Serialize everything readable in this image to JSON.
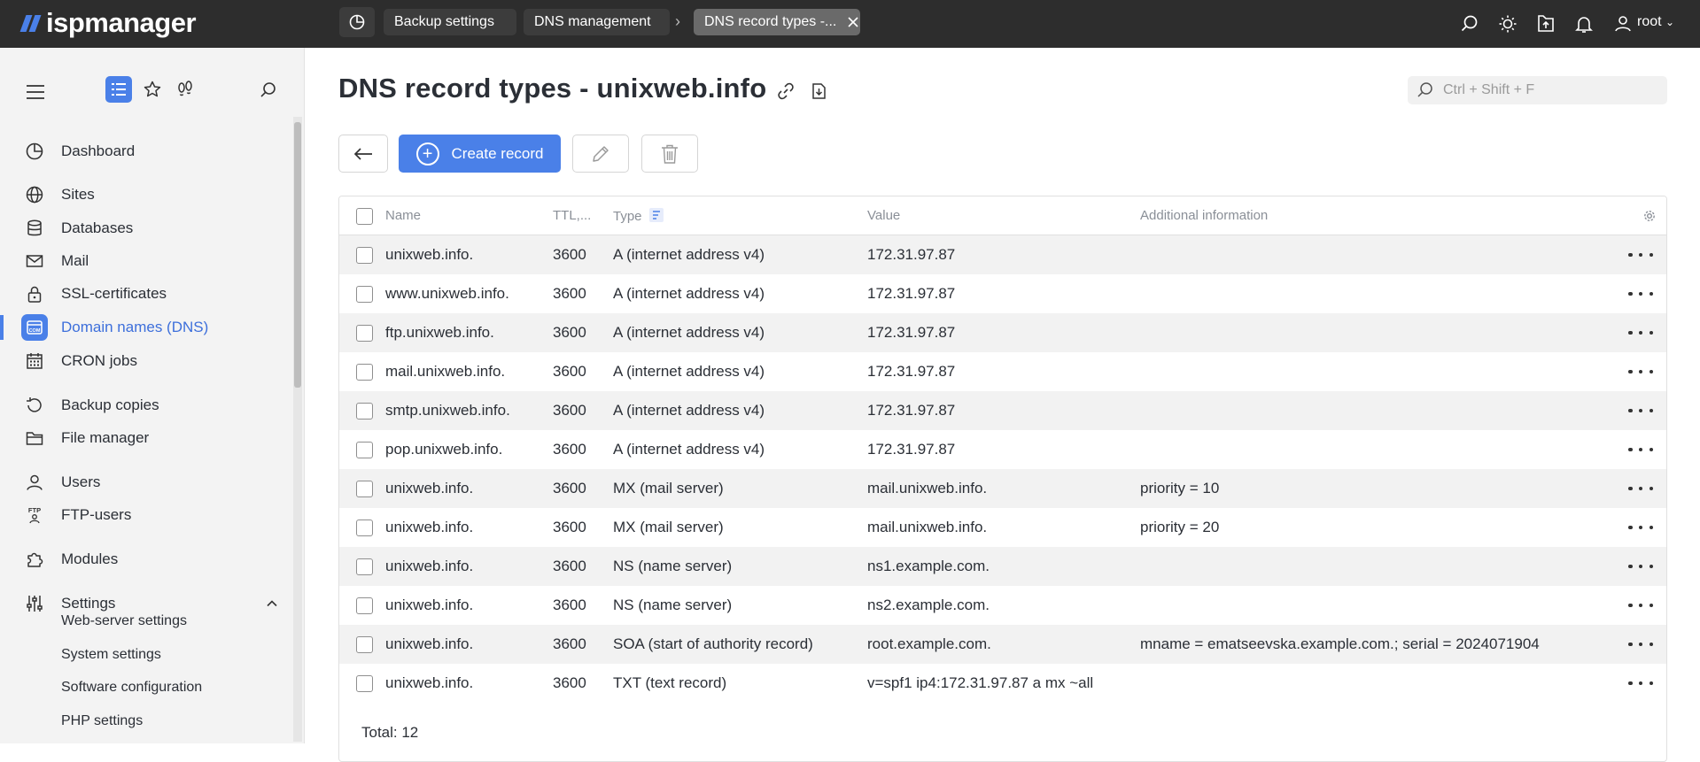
{
  "app": {
    "logo": "ispmanager"
  },
  "tabs": [
    {
      "label": "Backup settings"
    },
    {
      "label": "DNS management"
    },
    {
      "label": "DNS record types -..."
    }
  ],
  "user": {
    "name": "root"
  },
  "sidebar": {
    "items": [
      {
        "label": "Dashboard",
        "icon": "dashboard-icon"
      },
      {
        "label": "Sites",
        "icon": "globe-icon"
      },
      {
        "label": "Databases",
        "icon": "database-icon"
      },
      {
        "label": "Mail",
        "icon": "mail-icon"
      },
      {
        "label": "SSL-certificates",
        "icon": "lock-icon"
      },
      {
        "label": "Domain names (DNS)",
        "icon": "dns-icon"
      },
      {
        "label": "CRON jobs",
        "icon": "calendar-icon"
      },
      {
        "label": "Backup copies",
        "icon": "backup-icon"
      },
      {
        "label": "File manager",
        "icon": "folder-icon"
      },
      {
        "label": "Users",
        "icon": "user-icon"
      },
      {
        "label": "FTP-users",
        "icon": "ftp-icon"
      },
      {
        "label": "Modules",
        "icon": "puzzle-icon"
      },
      {
        "label": "Settings",
        "icon": "sliders-icon"
      }
    ],
    "settings_sub": [
      {
        "label": "Web-server settings"
      },
      {
        "label": "System settings"
      },
      {
        "label": "Software configuration"
      },
      {
        "label": "PHP settings"
      }
    ]
  },
  "page": {
    "title": "DNS record types - unixweb.info",
    "search_placeholder": "Ctrl + Shift + F",
    "create_label": "Create record"
  },
  "table": {
    "columns": {
      "name": "Name",
      "ttl": "TTL,...",
      "type": "Type",
      "value": "Value",
      "info": "Additional information"
    },
    "rows": [
      {
        "name": "unixweb.info.",
        "ttl": "3600",
        "type": "A (internet address v4)",
        "value": "172.31.97.87",
        "info": ""
      },
      {
        "name": "www.unixweb.info.",
        "ttl": "3600",
        "type": "A (internet address v4)",
        "value": "172.31.97.87",
        "info": ""
      },
      {
        "name": "ftp.unixweb.info.",
        "ttl": "3600",
        "type": "A (internet address v4)",
        "value": "172.31.97.87",
        "info": ""
      },
      {
        "name": "mail.unixweb.info.",
        "ttl": "3600",
        "type": "A (internet address v4)",
        "value": "172.31.97.87",
        "info": ""
      },
      {
        "name": "smtp.unixweb.info.",
        "ttl": "3600",
        "type": "A (internet address v4)",
        "value": "172.31.97.87",
        "info": ""
      },
      {
        "name": "pop.unixweb.info.",
        "ttl": "3600",
        "type": "A (internet address v4)",
        "value": "172.31.97.87",
        "info": ""
      },
      {
        "name": "unixweb.info.",
        "ttl": "3600",
        "type": "MX (mail server)",
        "value": "mail.unixweb.info.",
        "info": "priority = 10"
      },
      {
        "name": "unixweb.info.",
        "ttl": "3600",
        "type": "MX (mail server)",
        "value": "mail.unixweb.info.",
        "info": "priority = 20"
      },
      {
        "name": "unixweb.info.",
        "ttl": "3600",
        "type": "NS (name server)",
        "value": "ns1.example.com.",
        "info": ""
      },
      {
        "name": "unixweb.info.",
        "ttl": "3600",
        "type": "NS (name server)",
        "value": "ns2.example.com.",
        "info": ""
      },
      {
        "name": "unixweb.info.",
        "ttl": "3600",
        "type": "SOA (start of authority record)",
        "value": "root.example.com.",
        "info": "mname = ematseevska.example.com.; serial = 2024071904"
      },
      {
        "name": "unixweb.info.",
        "ttl": "3600",
        "type": "TXT (text record)",
        "value": "v=spf1 ip4:172.31.97.87 a mx ~all",
        "info": ""
      }
    ],
    "total": "Total: 12"
  },
  "colors": {
    "accent": "#4a80e8",
    "topbar": "#2d2d2d"
  }
}
